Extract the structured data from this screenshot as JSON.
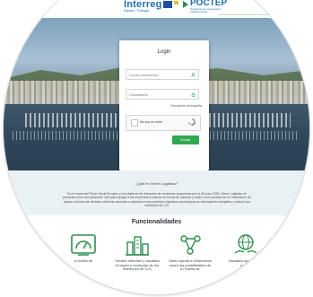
{
  "header": {
    "interreg_logo_text": "Interreg",
    "interreg_logo_sub": "España - Portugal",
    "poctep_logo_text": "POCTEP",
    "poctep_logo_sub": "Programa de cooperación transfronteriza"
  },
  "login": {
    "title": "Login",
    "email_placeholder": "Correo electrónico",
    "password_placeholder": "Contraseña",
    "forgot_link": "Recuperar contraseña",
    "captcha_label": "No soy un robot",
    "submit_label": "Entrar"
  },
  "about": {
    "title": "¿Qué es Green Logistics?",
    "text": "En el marco del Pacto Verde Europeo y los objetivos de reducción de emisiones propuestos por la UE para 2050, Green Logistics se presenta como una aplicación web para apoyar a las empresas a calcular su huella de carbono y dotar a sus usuarios de un mecanismo de ayuda a la toma de decisión sobre las acciones a ejecutar en sus procesos logísticos para mejorar su desempeño energético y reducir sus emisiones de CO₂"
  },
  "features": {
    "title": "Funcionalidades",
    "items": [
      {
        "label": "a Huella de",
        "icon": "gauge-icon"
      },
      {
        "label": "Genera informes y visualiza el origen y evolución de tus emisiones de CO₂",
        "icon": "city-icon"
      },
      {
        "label": "Obtén ayuda e información sobre las posibilidades de tu Huella de",
        "icon": "network-icon"
      },
      {
        "label": "Visualiza opciones de mejora",
        "icon": "globe-hands-icon"
      }
    ]
  },
  "colors": {
    "accent_green": "#2fa84f",
    "icon_green": "#2f8f4e",
    "brand_blue": "#1e6fb3",
    "about_bg": "#eaf1f4"
  }
}
